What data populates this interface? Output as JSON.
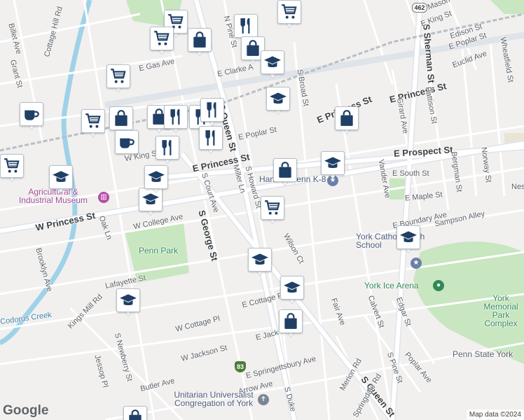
{
  "map": {
    "credit": "Map data ©2024",
    "logo": "Google",
    "colors": {
      "background": "#f1f0ee",
      "road": "#ffffff",
      "major_road": "#dfe3ea",
      "park": "#c8e6c0",
      "water": "#9fd2e8",
      "rail": "#b9bec6",
      "pin_icon": "#1f3f66"
    }
  },
  "streets": [
    {
      "name": "E Princess St"
    },
    {
      "name": "E Prospect St"
    },
    {
      "name": "E South St"
    },
    {
      "name": "E Maple St"
    },
    {
      "name": "E Boundary Ave"
    },
    {
      "name": "Sampson Alley"
    },
    {
      "name": "W Princess St"
    },
    {
      "name": "W King St"
    },
    {
      "name": "W College Ave"
    },
    {
      "name": "S George St"
    },
    {
      "name": "S Queen St"
    },
    {
      "name": "Wilson Ct"
    },
    {
      "name": "E Cottage Pl"
    },
    {
      "name": "W Cottage Pl"
    },
    {
      "name": "W Jackson St"
    },
    {
      "name": "E Springettsbury Ave"
    },
    {
      "name": "Arrow Ave"
    },
    {
      "name": "Butler Ave"
    },
    {
      "name": "Lafayette St"
    },
    {
      "name": "Kings Mill Rd"
    },
    {
      "name": "Brooklyn Ave"
    },
    {
      "name": "Oak Ln"
    },
    {
      "name": "S Court Ave"
    },
    {
      "name": "Miller Ln"
    },
    {
      "name": "S Howard St"
    },
    {
      "name": "S Broad St"
    },
    {
      "name": "Girard Ave"
    },
    {
      "name": "Pattison St"
    },
    {
      "name": "Vander Ave"
    },
    {
      "name": "Bergman St"
    },
    {
      "name": "Norway St"
    },
    {
      "name": "S Sherman St"
    },
    {
      "name": "Euclid Ave"
    },
    {
      "name": "Wheatfield St"
    },
    {
      "name": "E Poplar St"
    },
    {
      "name": "Edison St"
    },
    {
      "name": "E King St"
    },
    {
      "name": "E Clarke A"
    },
    {
      "name": "E Gas Ave"
    },
    {
      "name": "N Pine St"
    },
    {
      "name": "Calvert St"
    },
    {
      "name": "Edgar St"
    },
    {
      "name": "Fair Ave"
    },
    {
      "name": "Merion Rd"
    },
    {
      "name": "Springdale Rd"
    },
    {
      "name": "S Pine St"
    },
    {
      "name": "Poplar Ave"
    },
    {
      "name": "Jessop Pl"
    },
    {
      "name": "S Newberry St"
    },
    {
      "name": "Cottage Hill Rd"
    },
    {
      "name": "Billet Ave"
    },
    {
      "name": "Grant St"
    },
    {
      "name": "E Mason"
    },
    {
      "name": "E Jack"
    },
    {
      "name": "S Duke"
    },
    {
      "name": "Nes"
    },
    {
      "name": "Sampson"
    },
    {
      "name": "E Poplar St"
    }
  ],
  "labels": {
    "hannah_penn": "Hannah Penn K-8",
    "museum": "Agricultural & Industrial Museum",
    "penn_park": "Penn Park",
    "york_catholic": "York Catholic High School",
    "york_ice_arena": "York Ice Arena",
    "york_memorial": "York Memorial Park Complex",
    "penn_state_york": "Penn State York",
    "unitarian": "Unitarian Universalist Congregation of York",
    "codorus_creek": "Codorus Creek",
    "route_462": "462",
    "route_83": "83"
  },
  "pins": [
    {
      "type": "shopping-cart",
      "label": "grocery"
    },
    {
      "type": "shopping-cart",
      "label": "grocery"
    },
    {
      "type": "shopping-bag",
      "label": "store"
    },
    {
      "type": "restaurant",
      "label": "restaurant"
    },
    {
      "type": "shopping-bag",
      "label": "store"
    },
    {
      "type": "school",
      "label": "school"
    },
    {
      "type": "school",
      "label": "school"
    },
    {
      "type": "shopping-cart",
      "label": "grocery"
    },
    {
      "type": "coffee",
      "label": "cafe"
    },
    {
      "type": "shopping-cart",
      "label": "grocery"
    },
    {
      "type": "shopping-bag",
      "label": "store"
    },
    {
      "type": "shopping-bag",
      "label": "store"
    },
    {
      "type": "restaurant",
      "label": "restaurant"
    },
    {
      "type": "restaurant",
      "label": "restaurant"
    },
    {
      "type": "restaurant",
      "label": "restaurant"
    },
    {
      "type": "coffee",
      "label": "cafe"
    },
    {
      "type": "restaurant",
      "label": "restaurant"
    },
    {
      "type": "restaurant",
      "label": "restaurant"
    },
    {
      "type": "shopping-bag",
      "label": "store"
    },
    {
      "type": "school",
      "label": "school"
    },
    {
      "type": "shopping-bag",
      "label": "store"
    },
    {
      "type": "school",
      "label": "school"
    },
    {
      "type": "shopping-cart",
      "label": "grocery"
    },
    {
      "type": "school",
      "label": "school"
    },
    {
      "type": "school",
      "label": "school"
    },
    {
      "type": "school",
      "label": "school"
    },
    {
      "type": "school",
      "label": "school"
    },
    {
      "type": "shopping-bag",
      "label": "store"
    },
    {
      "type": "school",
      "label": "school"
    },
    {
      "type": "shopping-cart",
      "label": "grocery"
    },
    {
      "type": "shopping-bag",
      "label": "store"
    },
    {
      "type": "school",
      "label": "school"
    },
    {
      "type": "shopping-cart",
      "label": "grocery"
    }
  ]
}
